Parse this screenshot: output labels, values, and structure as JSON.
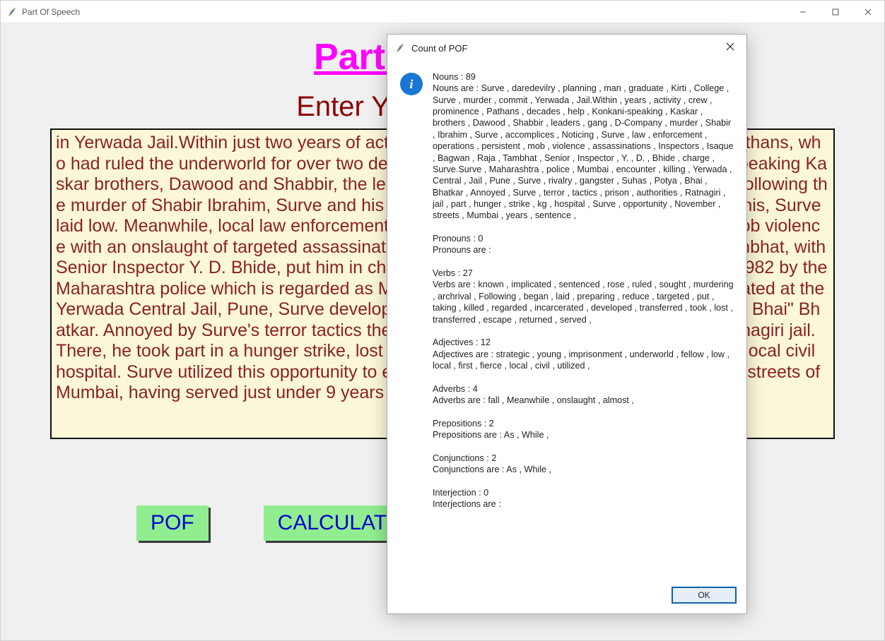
{
  "window": {
    "title": "Part Of Speech"
  },
  "header": {
    "title": "Part of Speech",
    "prompt": "Enter Your text or news"
  },
  "textarea": {
    "value": "in Yerwada Jail.Within just two years of activity, Surve's crew rose to prominence, the Pathans, who had ruled the underworld for over two decades, sought his help against the Konkani-speaking Kaskar brothers, Dawood and Shabbir, the leaders of the gang that became D-Company.\n\nFollowing the murder of Shabir Ibrahim, Surve and his accomplices began murdering one. Noticing this, Surve laid low. Meanwhile, local law enforcement operations, preparing to reduce persistent mob violence with an onslaught of targeted assassinations, Inspectors Isaque Bagwan and Raja Tambhat, with Senior Inspector Y. D. Bhide, put him in charge of taking out Surve. Surve was killed in 1982 by the Maharashtra police which is regarded as Mumbai's first encounter killing.\n\nWhile incarcerated at the Yerwada Central Jail, Pune, Surve developed a fierce rivalry with gangster Suhas \"Potya Bhai\" Bhatkar. Annoyed by Surve's terror tactics the prison authorities had him transferred to Ratnagiri jail. There, he took part in a hunger strike, lost almost 20 kgs before being transferred to the local civil hospital. Surve utilized this opportunity to escape in November 1979 and returned to the streets of Mumbai, having served just under 9 years of his sentence."
  },
  "buttons": {
    "pof": "POF",
    "calculate": "CALCULATE"
  },
  "dialog": {
    "title": "Count of POF",
    "ok": "OK",
    "nouns_count": "Nouns : 89",
    "nouns_list": "Nouns are : Surve , daredevilry , planning , man , graduate , Kirti , College , Surve , murder , commit , Yerwada , Jail.Within , years , activity , crew , prominence , Pathans , decades , help , Konkani-speaking , Kaskar , brothers , Dawood , Shabbir , leaders , gang , D-Company , murder , Shabir , Ibrahim , Surve , accomplices , Noticing , Surve , law , enforcement , operations , persistent , mob , violence , assassinations , Inspectors , Isaque , Bagwan , Raja , Tambhat , Senior , Inspector , Y. , D. , Bhide , charge , Surve.Surve , Maharashtra , police , Mumbai , encounter , killing , Yerwada , Central , Jail , Pune , Surve , rivalry , gangster , Suhas , Potya , Bhai , Bhatkar , Annoyed , Surve , terror , tactics , prison , authorities , Ratnagiri , jail , part , hunger , strike , kg , hospital , Surve , opportunity , November , streets , Mumbai , years , sentence ,",
    "pronouns_count": "Pronouns : 0",
    "pronouns_list": "Pronouns are :",
    "verbs_count": "Verbs : 27",
    "verbs_list": "Verbs are : known , implicated , sentenced , rose , ruled , sought , murdering , archrival , Following , began , laid , preparing , reduce , targeted , put , taking , killed , regarded , incarcerated , developed , transferred , took , lost , transferred , escape , returned , served ,",
    "adjectives_count": "Adjectives : 12",
    "adjectives_list": "Adjectives are : strategic , young , imprisonment , underworld , fellow , low , local , first , fierce , local , civil , utilized ,",
    "adverbs_count": "Adverbs : 4",
    "adverbs_list": "Adverbs are : fall , Meanwhile , onslaught , almost ,",
    "prepositions_count": "Prepositions : 2",
    "prepositions_list": "Prepositions are : As , While ,",
    "conjunctions_count": "Conjunctions : 2",
    "conjunctions_list": "Conjunctions are : As , While ,",
    "interjection_count": "Interjection : 0",
    "interjections_list": "Interjections are :"
  }
}
